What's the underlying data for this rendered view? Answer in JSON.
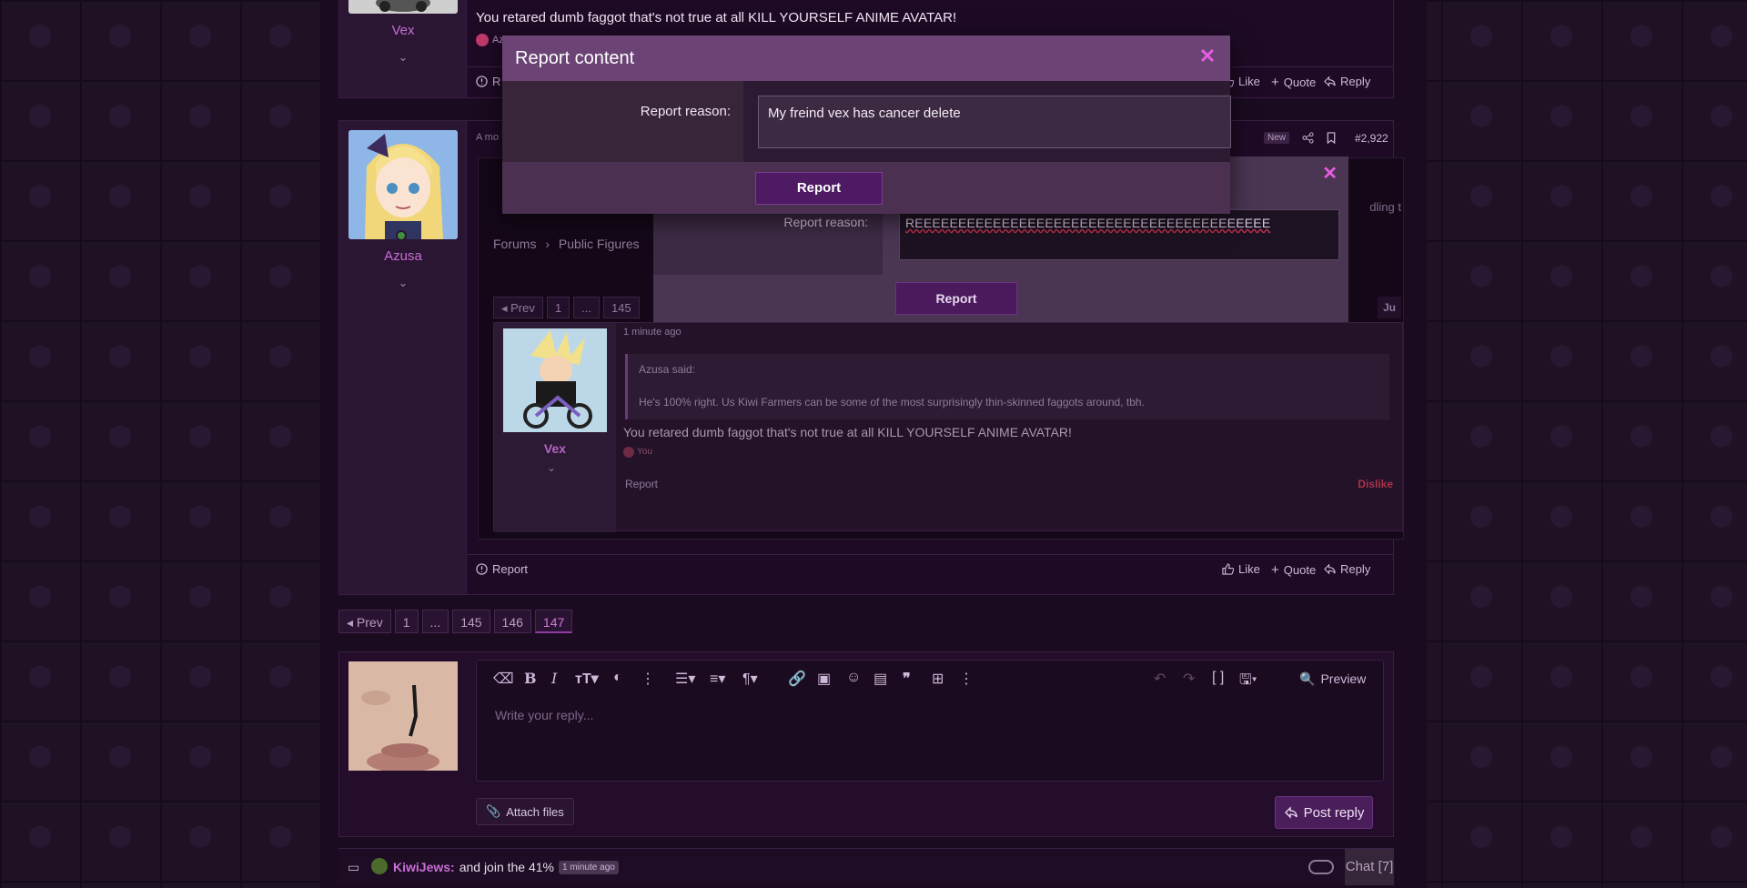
{
  "top_post": {
    "username": "Vex",
    "message": "You retared dumb faggot that's not true at all KILL YOURSELF ANIME AVATAR!",
    "reaction_user_prefix": "Az",
    "actions": {
      "report_prefix": "R",
      "like": "Like",
      "quote": "Quote",
      "reply": "Reply"
    }
  },
  "second_post": {
    "username": "Azusa",
    "time_prefix": "A mo",
    "new_badge": "New",
    "post_number": "#2,922",
    "actions": {
      "report": "Report",
      "like": "Like",
      "quote": "Quote",
      "reply": "Reply"
    },
    "embedded_screenshot": {
      "breadcrumb": [
        "Forums",
        "Public Figures"
      ],
      "side_text": "dling t",
      "pager": [
        "Prev",
        "1",
        "...",
        "145"
      ],
      "jump_label": "Ju",
      "inner_post": {
        "time": "1 minute ago",
        "username": "Vex",
        "quote_author": "Azusa said:",
        "quote_text": "He's 100% right. Us Kiwi Farmers can be some of the most surprisingly thin-skinned faggots around, tbh.",
        "message": "You retared dumb faggot that's not true at all KILL YOURSELF ANIME AVATAR!",
        "reaction_label": "You",
        "report": "Report",
        "dislike": "Dislike"
      },
      "modal": {
        "label": "Report reason:",
        "value": "REEEEEEEEEEEEEEEEEEEEEEEEEEEEEEEEEEEEEEEEE",
        "button": "Report"
      }
    }
  },
  "modal": {
    "title": "Report content",
    "label": "Report reason:",
    "value": "My freind vex has cancer delete",
    "button": "Report"
  },
  "pager": {
    "prev": "Prev",
    "pages": [
      "1",
      "...",
      "145",
      "146",
      "147"
    ],
    "current": "147"
  },
  "reply": {
    "placeholder": "Write your reply...",
    "preview": "Preview",
    "attach": "Attach files",
    "post_reply": "Post reply"
  },
  "chat": {
    "user": "KiwiJews:",
    "message": "and join the 41%",
    "time": "1 minute ago",
    "button": "Chat [7]"
  },
  "colors": {
    "accent": "#c96ed6",
    "dislike": "#e0506a",
    "close": "#e85ce0"
  }
}
